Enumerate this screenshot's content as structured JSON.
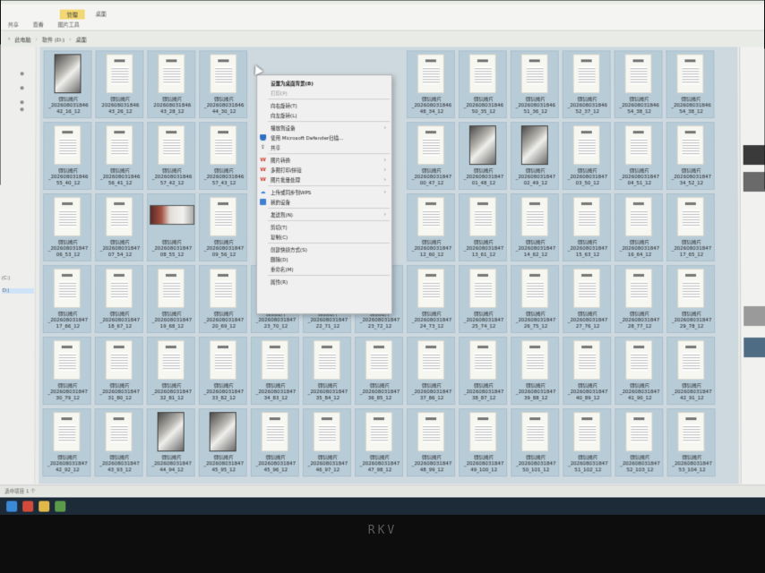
{
  "ribbon": {
    "tabs": [
      {
        "label": "共享"
      },
      {
        "label": "查看"
      },
      {
        "label": "图片工具"
      },
      {
        "label": "管理"
      },
      {
        "label": "桌面"
      }
    ]
  },
  "address_bar": {
    "crumbs": [
      {
        "label": "此电脑"
      },
      {
        "label": "软件 (D:)"
      },
      {
        "label": "桌面"
      }
    ]
  },
  "left_pane": {
    "drives": [
      {
        "label": "(C:)"
      },
      {
        "label": "D:)"
      }
    ]
  },
  "files": {
    "caption": "微信图片",
    "items": [
      {
        "name": "_202608031846",
        "suffix": "42_16_12",
        "thumb": "photo"
      },
      {
        "name": "202608031846",
        "suffix": "43_26_12",
        "thumb": "doc"
      },
      {
        "name": "202608031846",
        "suffix": "43_28_12",
        "thumb": "doc"
      },
      {
        "name": "_202608031846",
        "suffix": "44_30_12",
        "thumb": "doc"
      },
      {
        "name": "_202608031846",
        "suffix": "48_34_12",
        "thumb": "doc"
      },
      {
        "name": "_202608031846",
        "suffix": "50_35_12",
        "thumb": "doc"
      },
      {
        "name": "_202608031846",
        "suffix": "51_36_12",
        "thumb": "doc"
      },
      {
        "name": "_202608031846",
        "suffix": "52_37_12",
        "thumb": "doc"
      },
      {
        "name": "_202608031846",
        "suffix": "54_38_12",
        "thumb": "doc"
      },
      {
        "name": "_202608031846",
        "suffix": "54_38_12",
        "thumb": "doc"
      },
      {
        "name": "_202608031846",
        "suffix": "55_40_12",
        "thumb": "doc"
      },
      {
        "name": "_202608031846",
        "suffix": "56_41_12",
        "thumb": "doc"
      },
      {
        "name": "_202608031846",
        "suffix": "57_42_12",
        "thumb": "doc"
      },
      {
        "name": "_202608031846",
        "suffix": "57_43_12",
        "thumb": "doc"
      },
      {
        "name": "_202608031847",
        "suffix": "00_47_12",
        "thumb": "doc"
      },
      {
        "name": "_202608031847",
        "suffix": "01_48_12",
        "thumb": "photo"
      },
      {
        "name": "_202608031847",
        "suffix": "02_49_12",
        "thumb": "photo"
      },
      {
        "name": "_202608031847",
        "suffix": "03_50_12",
        "thumb": "doc"
      },
      {
        "name": "_202608031847",
        "suffix": "04_51_12",
        "thumb": "doc"
      },
      {
        "name": "_202608031847",
        "suffix": "34_52_12",
        "thumb": "doc"
      },
      {
        "name": "_202608031847",
        "suffix": "06_53_12",
        "thumb": "doc"
      },
      {
        "name": "_202608031847",
        "suffix": "07_54_12",
        "thumb": "doc"
      },
      {
        "name": "_202608031847",
        "suffix": "08_55_12",
        "thumb": "wide"
      },
      {
        "name": "_202608031847",
        "suffix": "09_56_12",
        "thumb": "doc"
      },
      {
        "name": "_202608031847",
        "suffix": "12_60_12",
        "thumb": "doc"
      },
      {
        "name": "_202608031847",
        "suffix": "13_61_12",
        "thumb": "doc"
      },
      {
        "name": "_202608031847",
        "suffix": "14_62_12",
        "thumb": "doc"
      },
      {
        "name": "_202608031847",
        "suffix": "15_63_12",
        "thumb": "doc"
      },
      {
        "name": "_202608031847",
        "suffix": "16_64_12",
        "thumb": "doc"
      },
      {
        "name": "_202608031847",
        "suffix": "17_65_12",
        "thumb": "doc"
      },
      {
        "name": "_202608031847",
        "suffix": "17_66_12",
        "thumb": "doc"
      },
      {
        "name": "_202608031847",
        "suffix": "18_67_12",
        "thumb": "doc"
      },
      {
        "name": "_202608031847",
        "suffix": "19_68_12",
        "thumb": "doc"
      },
      {
        "name": "_202608031847",
        "suffix": "20_69_12",
        "thumb": "doc"
      },
      {
        "name": "_202608031847",
        "suffix": "23_70_12",
        "thumb": "doc"
      },
      {
        "name": "_202608031847",
        "suffix": "22_71_12",
        "thumb": "doc"
      },
      {
        "name": "_202608031847",
        "suffix": "23_72_12",
        "thumb": "doc"
      },
      {
        "name": "_202608031847",
        "suffix": "24_73_12",
        "thumb": "doc"
      },
      {
        "name": "_202608031847",
        "suffix": "25_74_12",
        "thumb": "doc"
      },
      {
        "name": "_202608031847",
        "suffix": "26_75_12",
        "thumb": "doc"
      },
      {
        "name": "_202608031847",
        "suffix": "27_76_12",
        "thumb": "doc"
      },
      {
        "name": "_202608031847",
        "suffix": "28_77_12",
        "thumb": "doc"
      },
      {
        "name": "_202608031847",
        "suffix": "29_78_12",
        "thumb": "doc"
      },
      {
        "name": "_202608031847",
        "suffix": "30_79_12",
        "thumb": "doc"
      },
      {
        "name": "_202608031847",
        "suffix": "31_80_12",
        "thumb": "doc"
      },
      {
        "name": "_202608031847",
        "suffix": "32_81_12",
        "thumb": "doc"
      },
      {
        "name": "_202608031847",
        "suffix": "33_82_12",
        "thumb": "doc"
      },
      {
        "name": "_202608031847",
        "suffix": "34_83_12",
        "thumb": "doc"
      },
      {
        "name": "_202608031847",
        "suffix": "35_84_12",
        "thumb": "doc"
      },
      {
        "name": "_202608031847",
        "suffix": "36_85_12",
        "thumb": "doc"
      },
      {
        "name": "_202608031847",
        "suffix": "37_86_12",
        "thumb": "doc"
      },
      {
        "name": "_202608031847",
        "suffix": "38_87_12",
        "thumb": "doc"
      },
      {
        "name": "_202608031847",
        "suffix": "39_88_12",
        "thumb": "doc"
      },
      {
        "name": "_202608031847",
        "suffix": "40_89_12",
        "thumb": "doc"
      },
      {
        "name": "_202608031847",
        "suffix": "41_90_12",
        "thumb": "doc"
      },
      {
        "name": "_202608031847",
        "suffix": "42_91_12",
        "thumb": "doc"
      },
      {
        "name": "_202608031847",
        "suffix": "42_92_12",
        "thumb": "doc"
      },
      {
        "name": "_202608031847",
        "suffix": "43_93_12",
        "thumb": "doc"
      },
      {
        "name": "_202608031847",
        "suffix": "44_94_12",
        "thumb": "photo"
      },
      {
        "name": "_202608031847",
        "suffix": "45_95_12",
        "thumb": "photo"
      },
      {
        "name": "_202608031847",
        "suffix": "45_96_12",
        "thumb": "doc"
      },
      {
        "name": "_202608031847",
        "suffix": "46_97_12",
        "thumb": "doc"
      },
      {
        "name": "_202608031847",
        "suffix": "47_98_12",
        "thumb": "doc"
      },
      {
        "name": "_202608031847",
        "suffix": "48_99_12",
        "thumb": "doc"
      },
      {
        "name": "_202608031847",
        "suffix": "49_100_12",
        "thumb": "doc"
      },
      {
        "name": "_202608031847",
        "suffix": "50_101_12",
        "thumb": "doc"
      },
      {
        "name": "_202608031847",
        "suffix": "51_102_12",
        "thumb": "doc"
      },
      {
        "name": "_202608031847",
        "suffix": "52_103_12",
        "thumb": "doc"
      },
      {
        "name": "_202608031847",
        "suffix": "53_104_12",
        "thumb": "doc"
      }
    ]
  },
  "context_menu": {
    "items": [
      {
        "label": "设置为桌面背景(B)",
        "icon": "",
        "bold": true
      },
      {
        "label": "打印(P)",
        "icon": "",
        "disabled": true
      },
      {
        "sep": true
      },
      {
        "label": "向右旋转(T)",
        "icon": ""
      },
      {
        "label": "向左旋转(L)",
        "icon": ""
      },
      {
        "sep": true
      },
      {
        "label": "播放到设备",
        "icon": "",
        "submenu": true
      },
      {
        "label": "使用 Microsoft Defender扫描...",
        "icon": "defender-shield-icon"
      },
      {
        "label": "共享",
        "icon": "share-icon"
      },
      {
        "sep": true
      },
      {
        "label": "图片转换",
        "icon": "wps-icon",
        "submenu": true
      },
      {
        "label": "多图打印/拼接",
        "icon": "wps-icon",
        "submenu": true
      },
      {
        "label": "图片批量处理",
        "icon": "wps-icon",
        "submenu": true
      },
      {
        "sep": true
      },
      {
        "label": "上传或同步到WPS",
        "icon": "cloud-icon",
        "submenu": true
      },
      {
        "label": "我的设备",
        "icon": "device-icon"
      },
      {
        "sep": true
      },
      {
        "label": "发送到(N)",
        "icon": "",
        "submenu": true
      },
      {
        "sep": true
      },
      {
        "label": "剪切(T)",
        "icon": ""
      },
      {
        "label": "复制(C)",
        "icon": ""
      },
      {
        "sep": true
      },
      {
        "label": "创建快捷方式(S)",
        "icon": ""
      },
      {
        "label": "删除(D)",
        "icon": ""
      },
      {
        "label": "重命名(M)",
        "icon": ""
      },
      {
        "sep": true
      },
      {
        "label": "属性(R)",
        "icon": ""
      }
    ]
  },
  "status_bar": {
    "left_text": "选中项目 1 个"
  },
  "bezel": {
    "brand": "RKV"
  },
  "colors": {
    "tile_selected": "#b8ccd8",
    "ribbon_manage": "#f2d873",
    "taskbar": "#1d2a38"
  }
}
